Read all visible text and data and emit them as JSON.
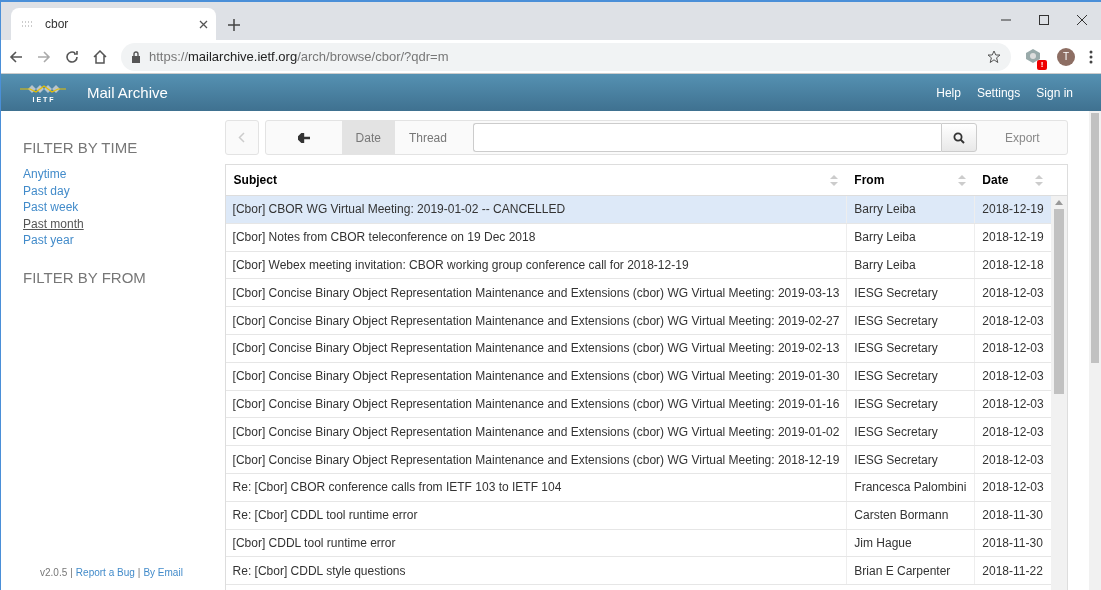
{
  "browser": {
    "tab": {
      "title": "cbor",
      "selected": true
    },
    "url": {
      "scheme": "https://",
      "host": "mailarchive.ietf.org",
      "path": "/arch/browse/cbor/?qdr=m"
    },
    "extension_badge": "!",
    "avatar": "T"
  },
  "header": {
    "logo_text": "I E T F",
    "title": "Mail Archive",
    "nav": [
      "Help",
      "Settings",
      "Sign in"
    ]
  },
  "sidebar": {
    "time_heading": "FILTER BY TIME",
    "time_filters": [
      {
        "label": "Anytime",
        "selected": false
      },
      {
        "label": "Past day",
        "selected": false
      },
      {
        "label": "Past week",
        "selected": false
      },
      {
        "label": "Past month",
        "selected": true
      },
      {
        "label": "Past year",
        "selected": false
      }
    ],
    "from_heading": "FILTER BY FROM",
    "footer": [
      {
        "kind": "text",
        "text": "v2.0.5"
      },
      {
        "kind": "sep",
        "text": "|"
      },
      {
        "kind": "link",
        "text": "Report a Bug"
      },
      {
        "kind": "sep",
        "text": "|"
      },
      {
        "kind": "link",
        "text": "By Email"
      }
    ]
  },
  "toolbar": {
    "previous_disabled": true,
    "views": [
      {
        "label": "Date",
        "selected": true
      },
      {
        "label": "Thread",
        "selected": false
      }
    ],
    "export": "Export"
  },
  "table": {
    "columns": [
      "Subject",
      "From",
      "Date"
    ],
    "rows": [
      {
        "subject": "[Cbor] CBOR WG Virtual Meeting: 2019-01-02 -- CANCELLED",
        "from": "Barry Leiba",
        "date": "2018-12-19",
        "selected": true
      },
      {
        "subject": "[Cbor] Notes from CBOR teleconference on 19 Dec 2018",
        "from": "Barry Leiba",
        "date": "2018-12-19",
        "selected": false
      },
      {
        "subject": "[Cbor] Webex meeting invitation: CBOR working group conference call for 2018-12-19",
        "from": "Barry Leiba",
        "date": "2018-12-18",
        "selected": false
      },
      {
        "subject": "[Cbor] Concise Binary Object Representation Maintenance and Extensions (cbor) WG Virtual Meeting: 2019-03-13",
        "from": "IESG Secretary",
        "date": "2018-12-03",
        "selected": false
      },
      {
        "subject": "[Cbor] Concise Binary Object Representation Maintenance and Extensions (cbor) WG Virtual Meeting: 2019-02-27",
        "from": "IESG Secretary",
        "date": "2018-12-03",
        "selected": false
      },
      {
        "subject": "[Cbor] Concise Binary Object Representation Maintenance and Extensions (cbor) WG Virtual Meeting: 2019-02-13",
        "from": "IESG Secretary",
        "date": "2018-12-03",
        "selected": false
      },
      {
        "subject": "[Cbor] Concise Binary Object Representation Maintenance and Extensions (cbor) WG Virtual Meeting: 2019-01-30",
        "from": "IESG Secretary",
        "date": "2018-12-03",
        "selected": false
      },
      {
        "subject": "[Cbor] Concise Binary Object Representation Maintenance and Extensions (cbor) WG Virtual Meeting: 2019-01-16",
        "from": "IESG Secretary",
        "date": "2018-12-03",
        "selected": false
      },
      {
        "subject": "[Cbor] Concise Binary Object Representation Maintenance and Extensions (cbor) WG Virtual Meeting: 2019-01-02",
        "from": "IESG Secretary",
        "date": "2018-12-03",
        "selected": false
      },
      {
        "subject": "[Cbor] Concise Binary Object Representation Maintenance and Extensions (cbor) WG Virtual Meeting: 2018-12-19",
        "from": "IESG Secretary",
        "date": "2018-12-03",
        "selected": false
      },
      {
        "subject": "Re: [Cbor] CBOR conference calls from IETF 103 to IETF 104",
        "from": "Francesca Palombini",
        "date": "2018-12-03",
        "selected": false
      },
      {
        "subject": "Re: [Cbor] CDDL tool runtime error",
        "from": "Carsten Bormann",
        "date": "2018-11-30",
        "selected": false
      },
      {
        "subject": "[Cbor] CDDL tool runtime error",
        "from": "Jim Hague",
        "date": "2018-11-30",
        "selected": false
      },
      {
        "subject": "Re: [Cbor] CDDL style questions",
        "from": "Brian E Carpenter",
        "date": "2018-11-22",
        "selected": false
      }
    ]
  }
}
